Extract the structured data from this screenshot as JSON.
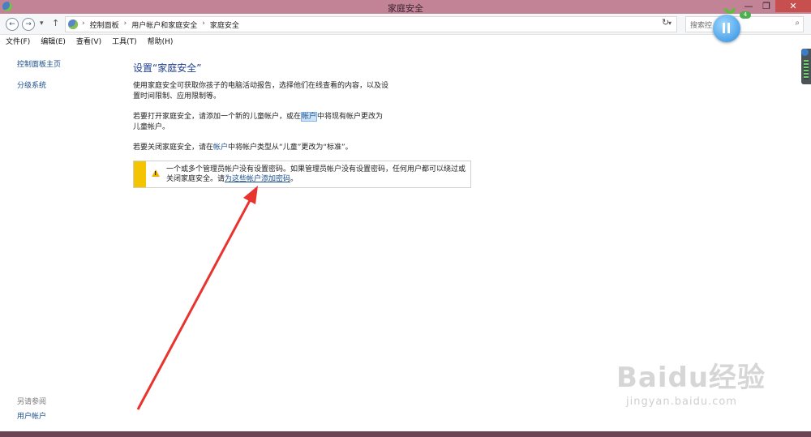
{
  "window": {
    "title": "家庭安全",
    "controls": [
      "—",
      "❐",
      "✕"
    ]
  },
  "nav": {
    "back_glyph": "←",
    "forward_glyph": "→",
    "recent_glyph": "▾",
    "up_glyph": "↑",
    "breadcrumbs": [
      "控制面板",
      "用户帐户和家庭安全",
      "家庭安全"
    ],
    "separator": "›",
    "dropdown_glyph": "▾",
    "refresh_glyph": "↻",
    "search_placeholder": "搜索控",
    "search_glyph": "⌕"
  },
  "menu": [
    "文件(F)",
    "编辑(E)",
    "查看(V)",
    "工具(T)",
    "帮助(H)"
  ],
  "sidebar": {
    "items": [
      "控制面板主页",
      "分级系统"
    ],
    "see_also_title": "另请参阅",
    "see_also_items": [
      "用户帐户"
    ]
  },
  "main": {
    "title": "设置“家庭安全”",
    "para1": "使用家庭安全可获取你孩子的电脑活动报告，选择他们在线查看的内容，以及设置时间限制、应用限制等。",
    "para2_before": "若要打开家庭安全，请添加一个新的儿童帐户，或在",
    "para2_link": "帐户",
    "para2_after": "中将现有帐户更改为儿童帐户。",
    "para3_before": "若要关闭家庭安全，请在",
    "para3_link": "帐户",
    "para3_after": "中将帐户类型从“儿童”更改为“标准”。"
  },
  "warning": {
    "text": "一个或多个管理员帐户没有设置密码。如果管理员帐户没有设置密码，任何用户都可以绕过或关闭家庭安全。请",
    "link": "为这些帐户添加密码",
    "end": "。"
  },
  "overlay": {
    "badge": "4"
  },
  "watermark": {
    "brand": "Baidu经验",
    "url": "jingyan.baidu.com"
  },
  "colors": {
    "titlebar": "#c18395",
    "link": "#1a4f8b",
    "heading": "#1e3e91",
    "warning": "#f5c400",
    "annotation_arrow": "#e8332f"
  }
}
